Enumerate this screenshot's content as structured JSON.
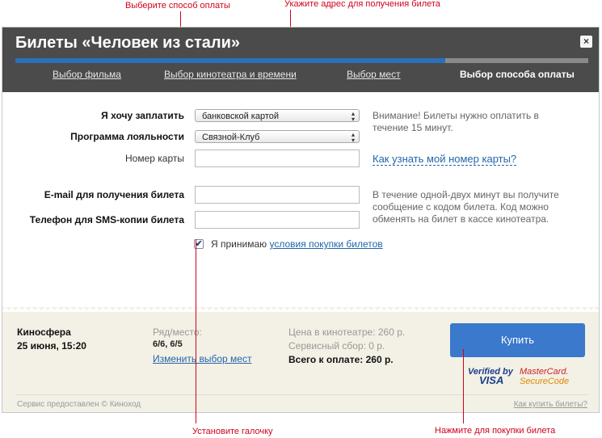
{
  "annotations": {
    "choose_payment": "Выберите способ оплаты",
    "enter_address": "Укажите адрес для получения билета",
    "set_checkbox": "Установите галочку",
    "click_buy": "Нажмите для покупки билета"
  },
  "dialog": {
    "title": "Билеты «Человек из стали»",
    "close_label": "×",
    "progress_percent": 75,
    "tabs": [
      {
        "label": "Выбор фильма"
      },
      {
        "label": "Выбор кинотеатра и времени"
      },
      {
        "label": "Выбор мест"
      },
      {
        "label": "Выбор способа оплаты"
      }
    ]
  },
  "form": {
    "pay_label": "Я хочу заплатить",
    "pay_value": "банковской картой",
    "loyalty_label": "Программа лояльности",
    "loyalty_value": "Связной-Клуб",
    "card_label": "Номер карты",
    "email_label": "E-mail для получения билета",
    "phone_label": "Телефон для SMS-копии билета",
    "note1_line1": "Внимание! Билеты нужно оплатить в",
    "note1_line2": "течение 15 минут.",
    "card_link": "Как узнать мой номер карты?",
    "note2_line1": "В течение одной-двух минут вы получите",
    "note2_line2": "сообщение с кодом билета. Код можно",
    "note2_line3": "обменять на билет в кассе кинотеатра.",
    "agree_text": "Я принимаю",
    "agree_link": "условия покупки билетов",
    "checkmark": "✔"
  },
  "summary": {
    "cinema": "Киносфера",
    "datetime": "25 июня, 15:20",
    "seat_label": "Ряд/место:",
    "seats": "6/6, 6/5",
    "change_seats": "Изменить выбор мест",
    "price_cinema": "Цена в кинотеатре: 260 р.",
    "service_fee": "Сервисный сбор: 0 р.",
    "total": "Всего к оплате: 260 р.",
    "buy_label": "Купить",
    "verified_by": "Verified by",
    "visa": "VISA",
    "mastercard": "MasterCard.",
    "securecode": "SecureCode"
  },
  "footer": {
    "credit": "Сервис предоставлен © Киноход",
    "how_to_buy": "Как купить билеты?"
  }
}
